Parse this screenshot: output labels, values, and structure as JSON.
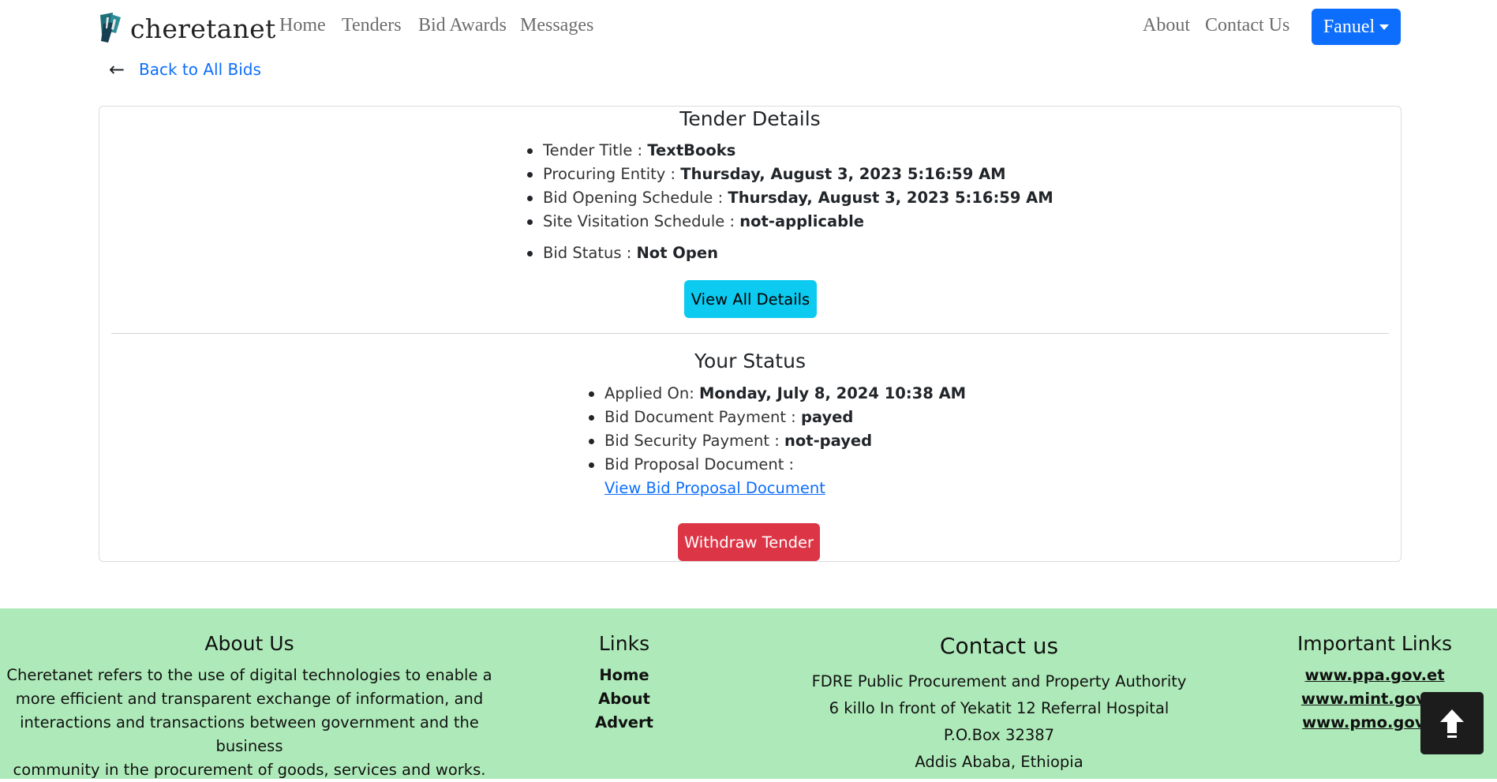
{
  "nav": {
    "brand": "cheretanet",
    "links": [
      "Home",
      "Tenders",
      "Bid Awards",
      "Messages"
    ],
    "right_links": [
      "About",
      "Contact Us"
    ],
    "user": "Fanuel"
  },
  "back_link": "Back to All Bids",
  "tender": {
    "title": "Tender Details",
    "items": [
      {
        "label": "Tender Title : ",
        "value": "TextBooks"
      },
      {
        "label": "Procuring Entity : ",
        "value": "Thursday, August 3, 2023 5:16:59 AM"
      },
      {
        "label": "Bid Opening Schedule : ",
        "value": "Thursday, August 3, 2023 5:16:59 AM"
      },
      {
        "label": "Site Visitation Schedule : ",
        "value": "not-applicable"
      },
      {
        "label": "Bid Status : ",
        "value": "Not Open"
      }
    ],
    "button": "View All Details"
  },
  "status": {
    "title": "Your Status",
    "items": [
      {
        "label": "Applied On: ",
        "value": "Monday, July 8, 2024 10:38 AM"
      },
      {
        "label": "Bid Document Payment : ",
        "value": "payed"
      },
      {
        "label": "Bid Security Payment : ",
        "value": "not-payed"
      },
      {
        "label": "Bid Proposal Document :",
        "value": ""
      }
    ],
    "proposal_link": "View Bid Proposal Document",
    "withdraw_button": "Withdraw Tender"
  },
  "footer": {
    "about_title": "About Us",
    "about_lines": [
      "Cheretanet refers to the use of digital technologies to enable a",
      "more efficient and transparent exchange of information, and",
      "interactions and transactions between government and the business",
      "community in the procurement of goods, services and works."
    ],
    "links_title": "Links",
    "links": [
      "Home",
      "About",
      "Advert"
    ],
    "contact_title": "Contact us",
    "contact_lines": [
      "FDRE Public Procurement and Property Authority",
      "6 killo In front of Yekatit 12 Referral Hospital",
      "P.O.Box 32387",
      "Addis Ababa, Ethiopia"
    ],
    "important_title": "Important Links",
    "important_links": [
      "www.ppa.gov.et",
      "www.mint.gov.et",
      "www.pmo.gov.et"
    ]
  },
  "colors": {
    "primary": "#0d6efd",
    "info": "#0dcaf0",
    "danger": "#dc3545",
    "footer_bg": "#aeeab9"
  },
  "icons": {
    "back": "arrow-left-icon",
    "to_top": "arrow-up-icon",
    "dropdown": "caret-down-icon"
  }
}
